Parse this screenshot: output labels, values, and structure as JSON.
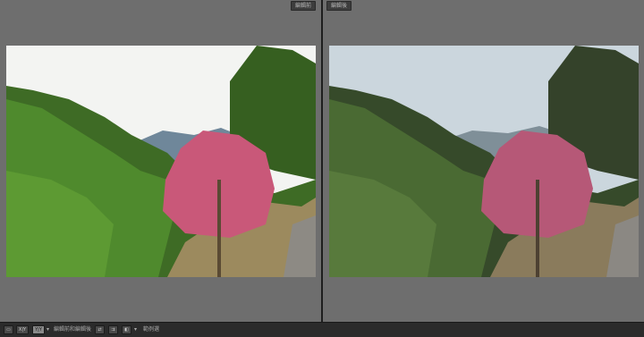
{
  "panes": {
    "before_label": "編輯前",
    "after_label": "編輯後"
  },
  "toolbar": {
    "view_loupe": "▭",
    "view_xy": "X|Y",
    "view_yy": "Y|Y",
    "caret_1": "▾",
    "compare_label": "編輯前和編輯後",
    "swap_button": "⇄",
    "copy_button": "⇉",
    "swap_view_button": "◧",
    "caret_2": "▾",
    "hint_label": "範例選"
  },
  "colors": {
    "window_bg": "#6e6e6e",
    "toolbar_bg": "#2b2b2b",
    "divider": "#1e1e1e"
  }
}
